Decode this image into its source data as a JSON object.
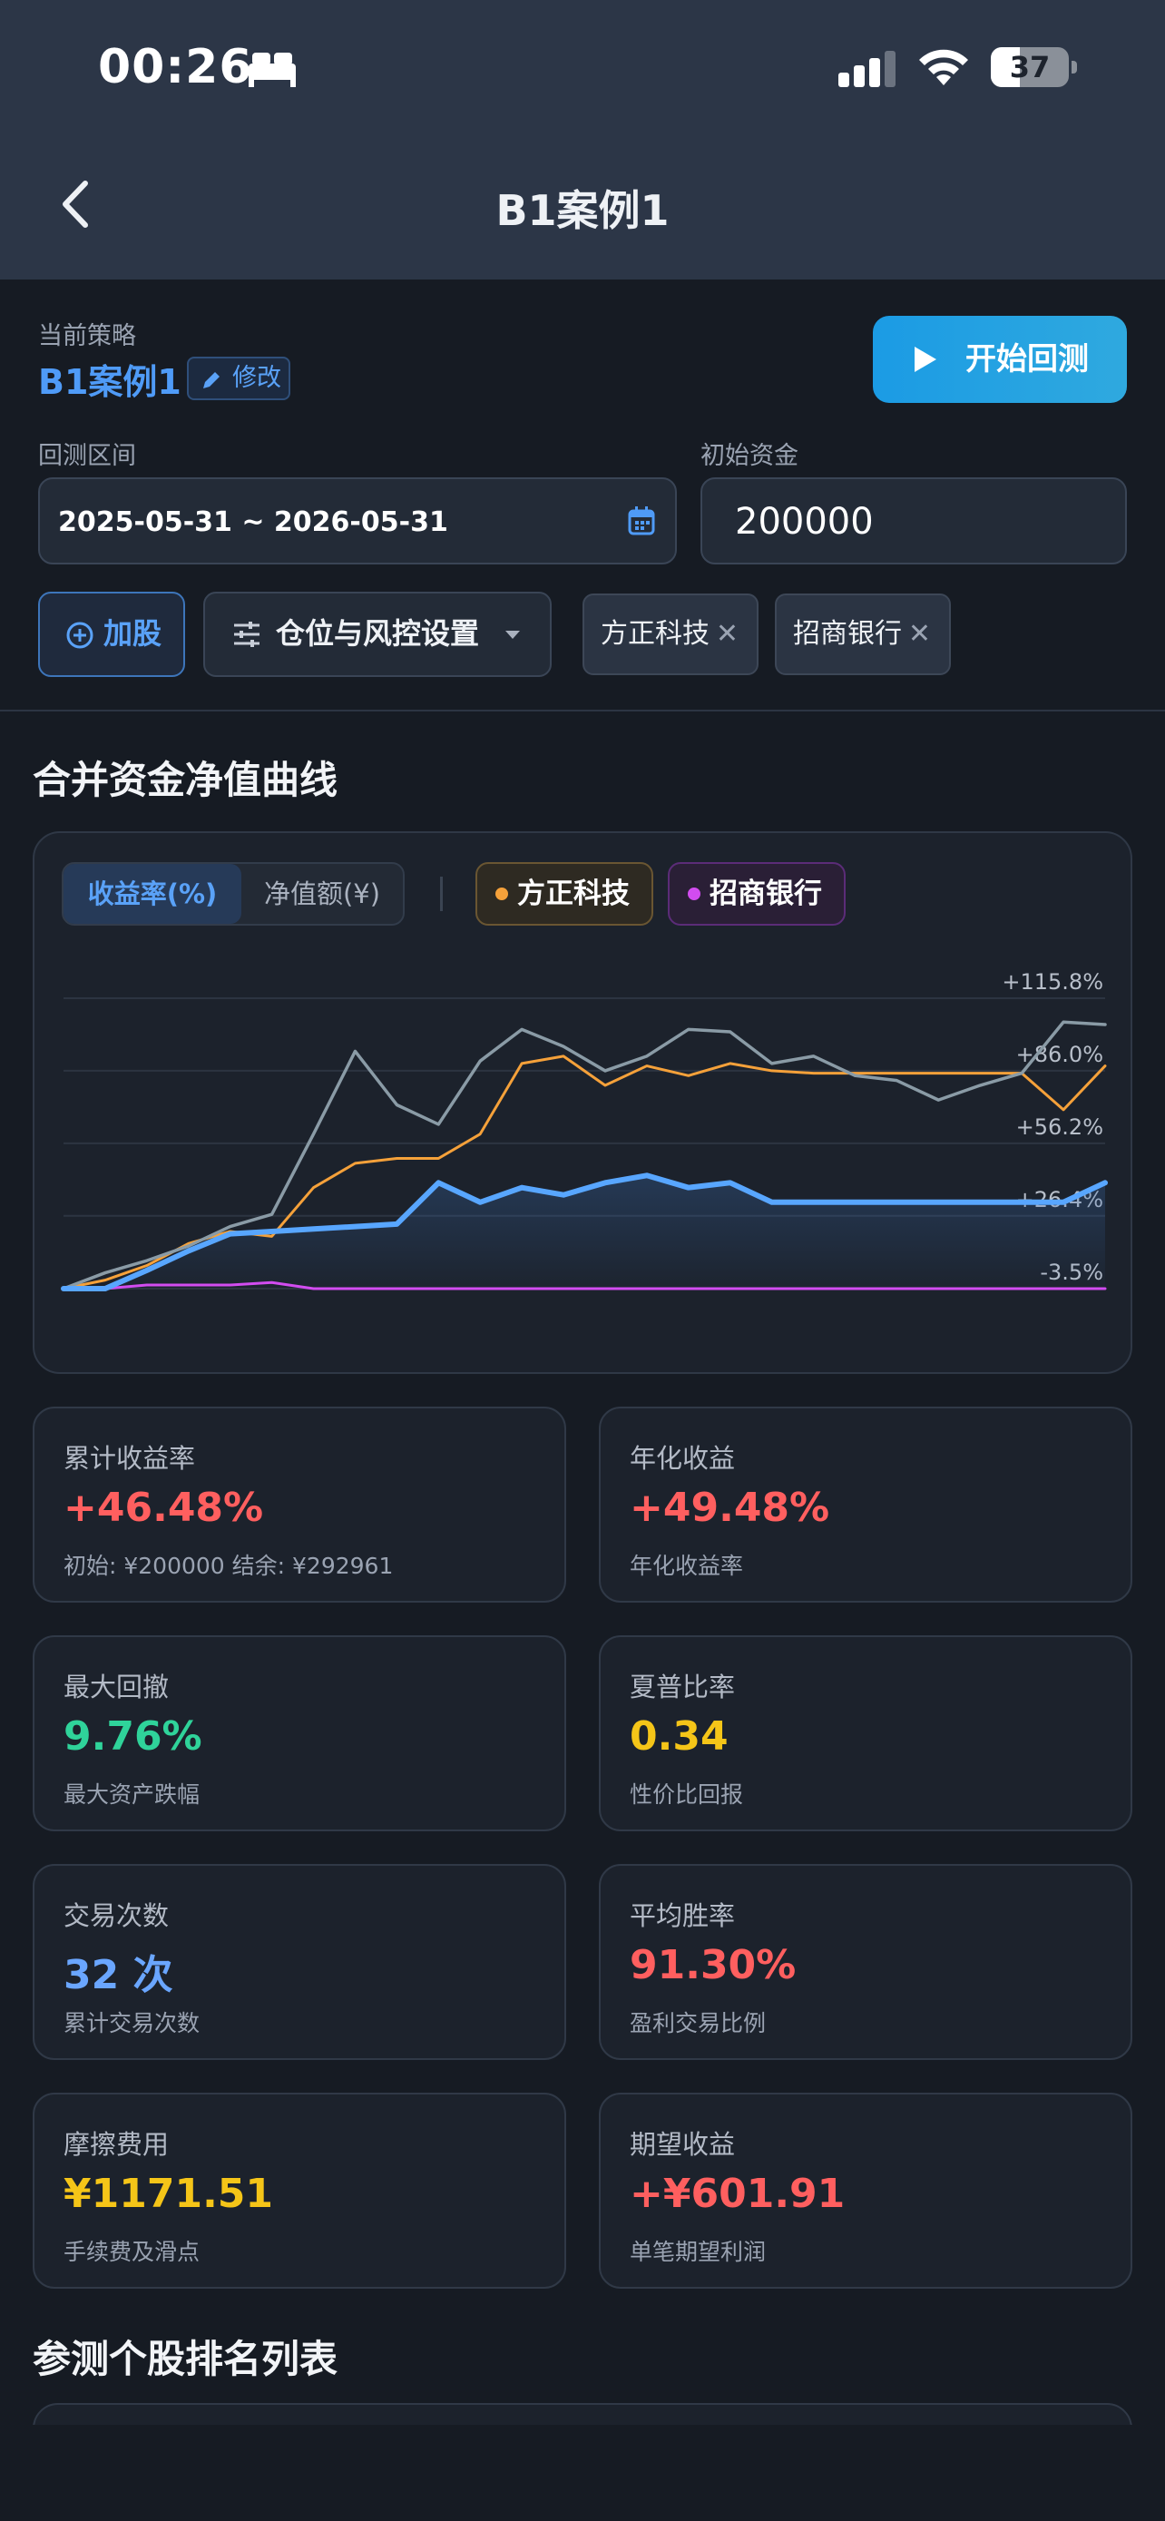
{
  "status_bar": {
    "time": "00:26",
    "battery": "37",
    "battery_level": 0.37
  },
  "nav": {
    "title": "B1案例1"
  },
  "strategy": {
    "label": "当前策略",
    "name": "B1案例1",
    "edit_label": "修改",
    "start_label": "开始回测"
  },
  "backtest": {
    "range_label": "回测区间",
    "range_value": "2025-05-31 ~ 2026-05-31",
    "capital_label": "初始资金",
    "capital_value": "200000"
  },
  "controls": {
    "add_label": "加股",
    "risk_label": "仓位与风控设置",
    "stocks": [
      {
        "name": "方正科技"
      },
      {
        "name": "招商银行"
      }
    ]
  },
  "chart_section": {
    "title": "合并资金净值曲线",
    "toggle": {
      "active": "收益率(%)",
      "inactive": "净值额(¥)"
    },
    "legend": [
      {
        "name": "方正科技",
        "color": "#f5a13a"
      },
      {
        "name": "招商银行",
        "color": "#d24cf0"
      }
    ]
  },
  "chart_data": {
    "type": "line",
    "y_ticks": [
      "+115.8%",
      "+86.0%",
      "+56.2%",
      "+26.4%",
      "-3.5%"
    ],
    "ylim": [
      -3.5,
      115.8
    ],
    "x": [
      0,
      4,
      8,
      12,
      16,
      20,
      24,
      28,
      32,
      36,
      40,
      44,
      48,
      52,
      56,
      60,
      64,
      68,
      72,
      76,
      80,
      84,
      88,
      92,
      96,
      100
    ],
    "series": [
      {
        "color": "#f5a13a",
        "values": [
          -3.5,
          0,
          6,
          15,
          20,
          18,
          38,
          48,
          50,
          50,
          60,
          89,
          92,
          80,
          88,
          84,
          89,
          86,
          85,
          85,
          85,
          85,
          85,
          85,
          70,
          88
        ]
      },
      {
        "color": "#d24cf0",
        "values": [
          -3.5,
          -3.5,
          -2,
          -2,
          -2,
          -1,
          -3.5,
          -3.5,
          -3.5,
          -3.5,
          -3.5,
          -3.5,
          -3.5,
          -3.5,
          -3.5,
          -3.5,
          -3.5,
          -3.5,
          -3.5,
          -3.5,
          -3.5,
          -3.5,
          -3.5,
          -3.5,
          -3.5,
          -3.5
        ]
      },
      {
        "color": "#8a9ba6",
        "values": [
          -3.5,
          3,
          8,
          14,
          22,
          27,
          60,
          94,
          72,
          64,
          90,
          103,
          96,
          86,
          92,
          103,
          102,
          89,
          92,
          84,
          82,
          74,
          80,
          85,
          106,
          105
        ]
      },
      {
        "color": "#58a6ff",
        "values": [
          -3.5,
          -3.5,
          4,
          12,
          19,
          20,
          21,
          22,
          23,
          40,
          32,
          38,
          35,
          40,
          43,
          38,
          40,
          32,
          32,
          32,
          32,
          32,
          32,
          32,
          32,
          40
        ]
      }
    ]
  },
  "stats": [
    {
      "label": "累计收益率",
      "value": "+46.48%",
      "sub": "初始: ¥200000  结余: ¥292961",
      "color": "#ff5f5f"
    },
    {
      "label": "年化收益",
      "value": "+49.48%",
      "sub": "年化收益率",
      "color": "#ff5f5f"
    },
    {
      "label": "最大回撤",
      "value": "9.76%",
      "sub": "最大资产跌幅",
      "color": "#2fd39a"
    },
    {
      "label": "夏普比率",
      "value": "0.34",
      "sub": "性价比回报",
      "color": "#f5c518"
    },
    {
      "label": "交易次数",
      "value": "32 次",
      "sub": "累计交易次数",
      "color": "#6aa6ff"
    },
    {
      "label": "平均胜率",
      "value": "91.30%",
      "sub": "盈利交易比例",
      "color": "#ff5f5f"
    },
    {
      "label": "摩擦费用",
      "value": "¥1171.51",
      "sub": "手续费及滑点",
      "color": "#f5c518"
    },
    {
      "label": "期望收益",
      "value": "+¥601.91",
      "sub": "单笔期望利润",
      "color": "#ff5f5f"
    }
  ],
  "ranking_section": {
    "title": "参测个股排名列表"
  }
}
